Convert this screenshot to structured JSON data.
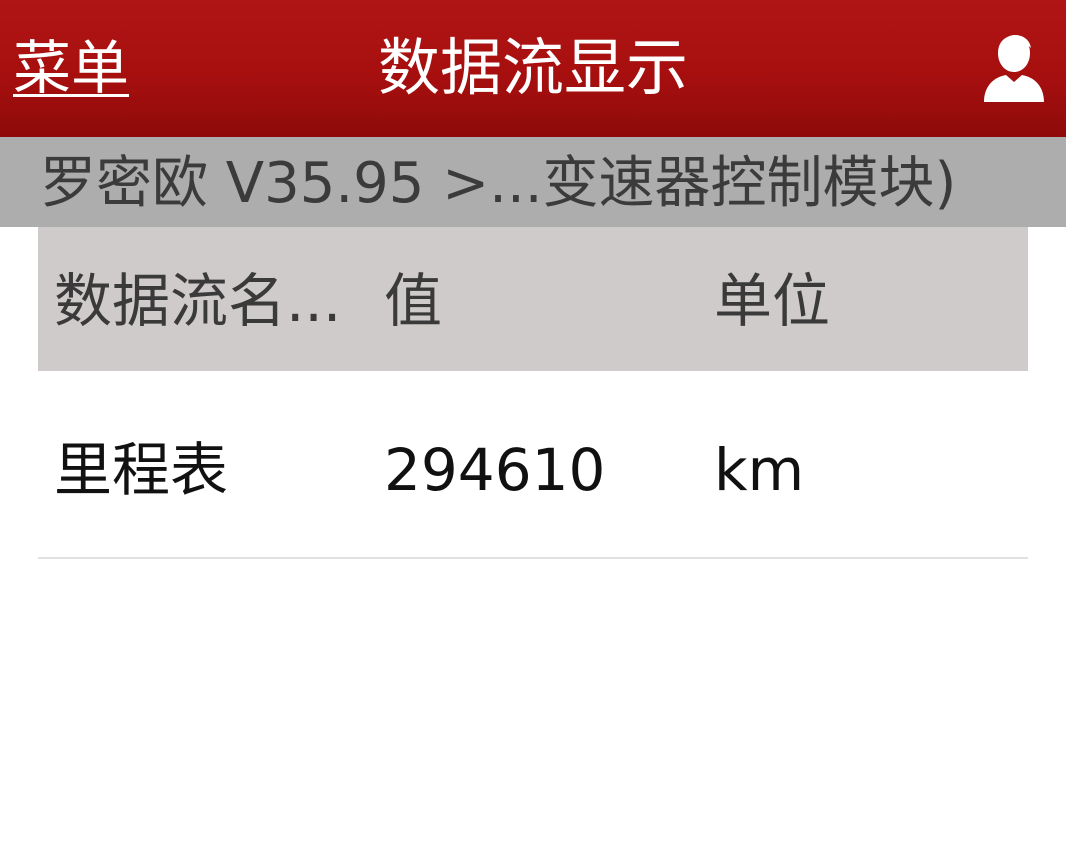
{
  "header": {
    "menu_label": "菜单",
    "title": "数据流显示",
    "user_icon": "user-silhouette-icon"
  },
  "breadcrumb": {
    "text": "罗密欧 V35.95 >...变速器控制模块)"
  },
  "table": {
    "columns": [
      "数据流名...",
      "值",
      "单位"
    ],
    "rows": [
      {
        "name": "里程表",
        "value": "294610",
        "unit": "km"
      }
    ]
  },
  "colors": {
    "header_red": "#a70f0f",
    "breadcrumb_gray": "#adadad",
    "table_header_gray": "#cfcbca"
  }
}
